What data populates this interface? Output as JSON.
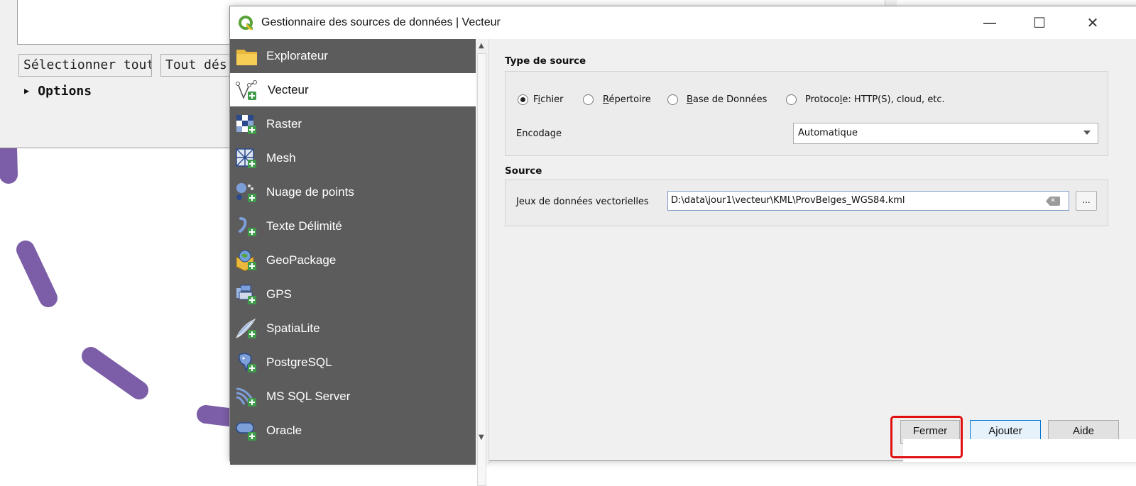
{
  "background_window": {
    "select_all_label": "Sélectionner tout",
    "deselect_all_label": "Tout dés",
    "options_label": "Options"
  },
  "dialog": {
    "title": "Gestionnaire des sources de données | Vecteur",
    "controls": {
      "minimize": "—",
      "maximize": "☐",
      "close": "✕"
    },
    "sidebar": {
      "items": [
        {
          "label": "Explorateur",
          "icon": "folder-icon"
        },
        {
          "label": "Vecteur",
          "icon": "vector-icon",
          "selected": true
        },
        {
          "label": "Raster",
          "icon": "raster-icon"
        },
        {
          "label": "Mesh",
          "icon": "mesh-icon"
        },
        {
          "label": "Nuage de points",
          "icon": "point-cloud-icon"
        },
        {
          "label": "Texte Délimité",
          "icon": "delimited-text-icon"
        },
        {
          "label": "GeoPackage",
          "icon": "geopackage-icon"
        },
        {
          "label": "GPS",
          "icon": "gps-icon"
        },
        {
          "label": "SpatiaLite",
          "icon": "spatialite-icon"
        },
        {
          "label": "PostgreSQL",
          "icon": "postgresql-icon"
        },
        {
          "label": "MS SQL Server",
          "icon": "mssql-icon"
        },
        {
          "label": "Oracle",
          "icon": "oracle-icon"
        }
      ]
    },
    "source_type": {
      "heading": "Type de source",
      "radio_file": {
        "pre": "F",
        "ul": "i",
        "post": "chier",
        "checked": true
      },
      "radio_directory": {
        "pre": "",
        "ul": "R",
        "post": "épertoire",
        "checked": false
      },
      "radio_database": {
        "pre": "",
        "ul": "B",
        "post": "ase de Données",
        "checked": false
      },
      "radio_protocol": {
        "pre": "Protoco",
        "ul": "l",
        "post": "e: HTTP(S), cloud, etc.",
        "checked": false
      },
      "encoding_label": "Encodage",
      "encoding_value": "Automatique"
    },
    "source": {
      "heading": "Source",
      "datasets_label": "Jeux de données vectorielles",
      "datasets_value": "D:\\data\\jour1\\vecteur\\KML\\ProvBelges_WGS84.kml",
      "browse_label": "..."
    },
    "buttons": {
      "close": "Fermer",
      "add": "Ajouter",
      "help": "Aide"
    }
  }
}
